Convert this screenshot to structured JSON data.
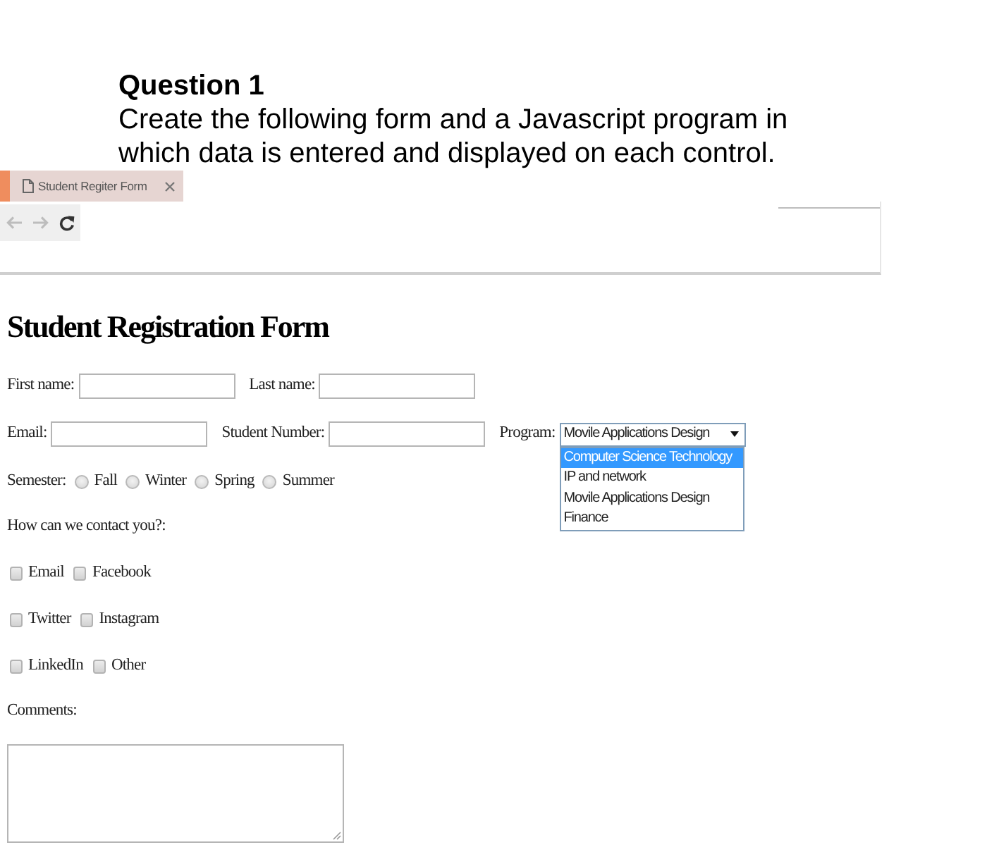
{
  "question": {
    "title": "Question 1",
    "text": "Create the following form and a Javascript program in which data is entered and displayed on each control."
  },
  "browser": {
    "tab": {
      "title": "Student Regiter Form",
      "selected": true
    }
  },
  "form": {
    "title": "Student Registration Form",
    "rows": [
      {
        "fields": [
          {
            "kind": "text",
            "label": "First name:"
          },
          {
            "kind": "text",
            "label": "Last name:"
          }
        ]
      },
      {
        "fields": [
          {
            "kind": "text",
            "label": "Email:"
          },
          {
            "kind": "text",
            "label": "Student Number:"
          },
          {
            "kind": "select",
            "label": "Program:",
            "value": "Movile Applications Design",
            "expanded": true,
            "options": [
              {
                "label": "Computer Science Technology",
                "highlighted": true
              },
              {
                "label": "IP and network",
                "highlighted": false
              },
              {
                "label": "Movile Applications Design",
                "highlighted": false
              },
              {
                "label": "Finance",
                "highlighted": false
              }
            ]
          }
        ]
      }
    ],
    "semester": {
      "label": "Semester:",
      "options": [
        {
          "label": "Fall",
          "selected": false
        },
        {
          "label": "Winter",
          "selected": false
        },
        {
          "label": "Spring",
          "selected": false
        },
        {
          "label": "Summer",
          "selected": false
        }
      ]
    },
    "contact": {
      "label": "How can we contact you?:",
      "rows": [
        [
          {
            "label": "Email",
            "checked": false
          },
          {
            "label": "Facebook",
            "checked": false
          }
        ],
        [
          {
            "label": "Twitter",
            "checked": false
          },
          {
            "label": "Instagram",
            "checked": false
          }
        ],
        [
          {
            "label": "LinkedIn",
            "checked": false
          },
          {
            "label": "Other",
            "checked": false
          }
        ]
      ]
    },
    "comments": {
      "label": "Comments:"
    }
  }
}
